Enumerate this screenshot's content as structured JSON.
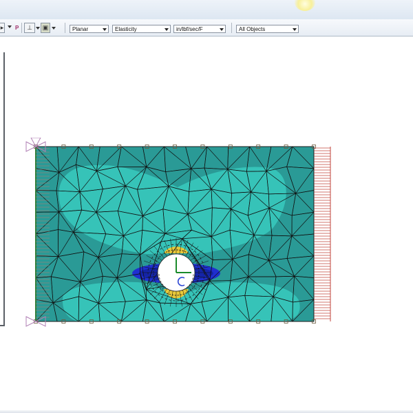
{
  "window": {
    "title": ""
  },
  "toolbar": {
    "p_label": "P",
    "analysis_type": "Planar",
    "analysis_model": "Elasticity",
    "units": "in/lbf/sec/F",
    "object_filter": "All Objects"
  },
  "canvas": {
    "model": "rectangular plate with central circular hole",
    "colors": {
      "plate_base": "#2a9a96",
      "plate_light": "#36c3b8",
      "stress_low": "#1f2fd0",
      "stress_high": "#e9c93a",
      "mesh": "#111111",
      "right_edge_load": "#c0463c",
      "left_fixed": "#2e7e3a",
      "support_symbol": "#b07fb4",
      "axis_x": "#1a8a2a",
      "axis_y": "#2f48d4"
    }
  }
}
